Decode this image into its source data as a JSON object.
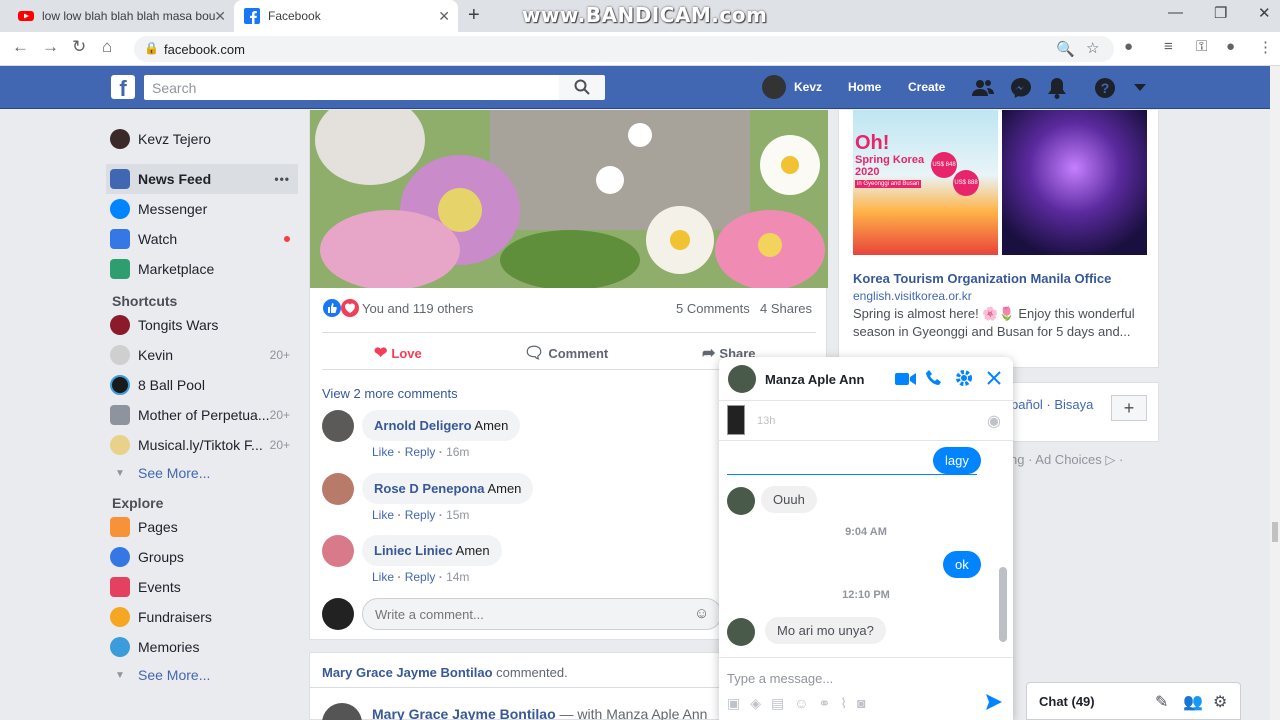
{
  "browser": {
    "tabs": [
      {
        "title": "low low blah blah blah masa bou"
      },
      {
        "title": "Facebook"
      }
    ],
    "url": "facebook.com",
    "overlay": "www.BANDICAM.com"
  },
  "fb": {
    "search_placeholder": "Search",
    "user_short": "Kevz",
    "nav_home": "Home",
    "nav_create": "Create"
  },
  "sidebar": {
    "profile": "Kevz Tejero",
    "main": [
      {
        "label": "News Feed",
        "icon": "news-feed-icon",
        "color": "#4267b2"
      },
      {
        "label": "Messenger",
        "icon": "messenger-icon",
        "color": "#0084ff"
      },
      {
        "label": "Watch",
        "icon": "watch-icon",
        "color": "#3578e5"
      },
      {
        "label": "Marketplace",
        "icon": "marketplace-icon",
        "color": "#2e9e6f"
      }
    ],
    "more_dots": "•••",
    "shortcuts_title": "Shortcuts",
    "shortcuts": [
      {
        "label": "Tongits Wars",
        "count": ""
      },
      {
        "label": "Kevin",
        "count": "20+"
      },
      {
        "label": "8 Ball Pool",
        "count": ""
      },
      {
        "label": "Mother of Perpetua...",
        "count": "20+"
      },
      {
        "label": "Musical.ly/Tiktok F...",
        "count": "20+"
      }
    ],
    "see_more": "See More...",
    "explore_title": "Explore",
    "explore": [
      {
        "label": "Pages",
        "color": "#f7923b"
      },
      {
        "label": "Groups",
        "color": "#3578e5"
      },
      {
        "label": "Events",
        "color": "#e4405f"
      },
      {
        "label": "Fundraisers",
        "color": "#f5a623"
      },
      {
        "label": "Memories",
        "color": "#3b9cdb"
      }
    ]
  },
  "post": {
    "reactions": "You and 119 others",
    "comments_count": "5 Comments",
    "shares_count": "4 Shares",
    "actions": {
      "love": "Love",
      "comment": "Comment",
      "share": "Share"
    },
    "view_more": "View 2 more comments",
    "comments": [
      {
        "author": "Arnold Deligero",
        "text": "Amen",
        "time": "16m"
      },
      {
        "author": "Rose D Penepona",
        "text": "Amen",
        "time": "15m"
      },
      {
        "author": "Liniec Liniec",
        "text": "Amen",
        "time": "14m"
      }
    ],
    "like": "Like",
    "reply": "Reply",
    "dot": "·",
    "write_placeholder": "Write a comment..."
  },
  "post2": {
    "header_name": "Mary Grace Jayme Bontilao",
    "header_action": "commented.",
    "sub_name": "Mary Grace Jayme Bontilao",
    "sub_with": "— with Manza Aple Ann"
  },
  "ad": {
    "img_text_1": "Oh!",
    "img_text_2": "Spring Korea",
    "img_text_3": "2020",
    "img_text_4": "in Gyeonggi and Busan",
    "price1": "US$ 848",
    "price2": "US$ 888",
    "title": "Korea Tourism Organization Manila Office",
    "url": "english.visitkorea.or.kr",
    "desc": "Spring is almost here! 🌸🌷 Enjoy this wonderful season in Gyeonggi and Busan for 5 days and..."
  },
  "lang": {
    "text": "pañol · Bisaya",
    "plus": "+",
    "footer": "ng · Ad Choices ▷ ·"
  },
  "chat": {
    "name": "Manza Aple Ann",
    "pinned_time": "13h",
    "messages": [
      {
        "dir": "out",
        "text": "lagy"
      },
      {
        "dir": "in",
        "text": "Ouuh"
      },
      {
        "dir": "ts",
        "text": "9:04 AM"
      },
      {
        "dir": "out",
        "text": "ok"
      },
      {
        "dir": "ts",
        "text": "12:10 PM"
      },
      {
        "dir": "in",
        "text": "Mo ari mo unya?"
      }
    ],
    "input_placeholder": "Type a message..."
  },
  "chatbar": {
    "label": "Chat (49)"
  }
}
